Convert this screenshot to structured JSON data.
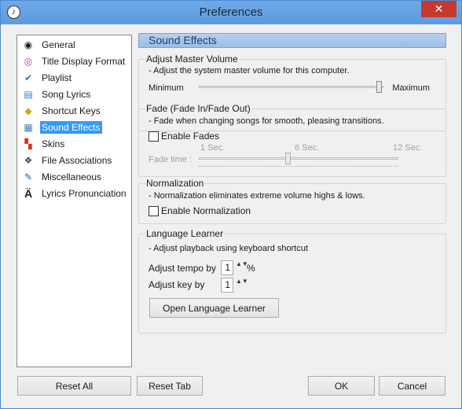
{
  "window": {
    "title": "Preferences",
    "close_glyph": "✕",
    "app_icon_glyph": "♪"
  },
  "sidebar": {
    "items": [
      {
        "label": "General",
        "icon": "speaker-icon",
        "glyph": "◉"
      },
      {
        "label": "Title Display Format",
        "icon": "disc-icon",
        "glyph": "◎"
      },
      {
        "label": "Playlist",
        "icon": "playlist-icon",
        "glyph": "✔"
      },
      {
        "label": "Song Lyrics",
        "icon": "lyrics-document-icon",
        "glyph": "▤"
      },
      {
        "label": "Shortcut Keys",
        "icon": "key-icon",
        "glyph": "◆"
      },
      {
        "label": "Sound Effects",
        "icon": "equalizer-icon",
        "glyph": "▦",
        "selected": true
      },
      {
        "label": "Skins",
        "icon": "skins-icon",
        "glyph": "▚"
      },
      {
        "label": "File Associations",
        "icon": "file-association-icon",
        "glyph": "❖"
      },
      {
        "label": "Miscellaneous",
        "icon": "misc-tools-icon",
        "glyph": "✎"
      },
      {
        "label": "Lyrics Pronunciation",
        "icon": "pronunciation-icon",
        "glyph": "Ä"
      }
    ]
  },
  "content": {
    "heading": "Sound Effects",
    "master_volume": {
      "title": "Adjust Master Volume",
      "desc": "- Adjust the system master volume for this computer.",
      "min_label": "Minimum",
      "max_label": "Maximum",
      "level_fraction": 0.98
    },
    "fade": {
      "title": "Fade (Fade In/Fade Out)",
      "desc": "- Fade when changing songs for smooth, pleasing transitions.",
      "checkbox_label": "Enable Fades",
      "checked": false,
      "time_label": "Fade time :",
      "tick_1": "1 Sec.",
      "tick_6": "6 Sec.",
      "tick_12": "12 Sec.",
      "time_fraction": 0.45
    },
    "normalization": {
      "title": "Normalization",
      "desc": "- Normalization eliminates extreme volume highs & lows.",
      "checkbox_label": "Enable Normalization",
      "checked": false
    },
    "language_learner": {
      "title": "Language Learner",
      "desc": "- Adjust playback using keyboard shortcut",
      "tempo_label": "Adjust tempo by",
      "tempo_value": "1",
      "tempo_unit": "%",
      "key_label": "Adjust key by",
      "key_value": "1",
      "open_button": "Open Language Learner",
      "spin_glyph": "▲▼"
    }
  },
  "footer": {
    "reset_all": "Reset All",
    "reset_tab": "Reset Tab",
    "ok": "OK",
    "cancel": "Cancel"
  },
  "colors": {
    "titlebar": "#63a2e6",
    "close": "#c7392f",
    "selection": "#3399ff",
    "heading_bar": "#9dbde6"
  }
}
